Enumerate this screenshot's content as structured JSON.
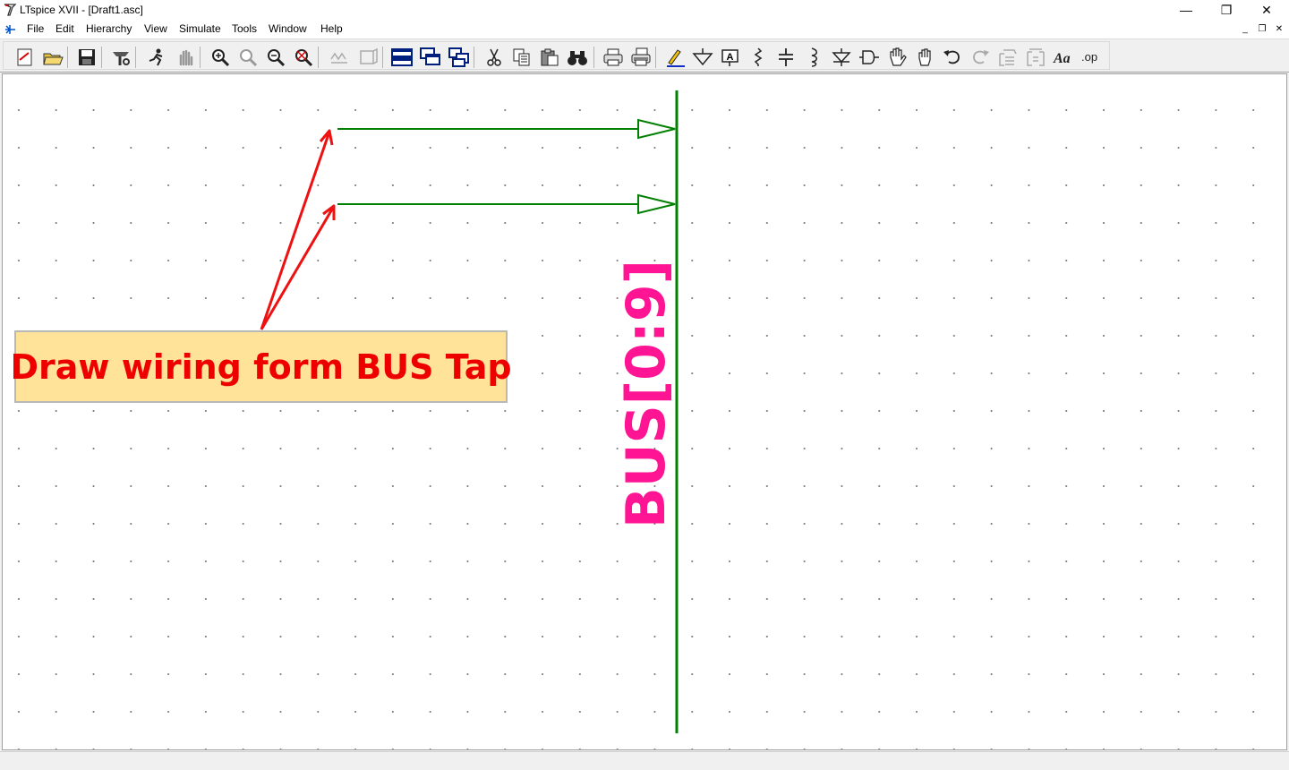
{
  "window": {
    "title": "LTspice XVII - [Draft1.asc]",
    "controls": {
      "minimize": "—",
      "restore": "❐",
      "close": "✕"
    },
    "mdi_controls": {
      "minimize": "_",
      "restore": "❐",
      "close": "✕"
    }
  },
  "menubar": {
    "items": [
      {
        "label": "File"
      },
      {
        "label": "Edit"
      },
      {
        "label": "Hierarchy"
      },
      {
        "label": "View"
      },
      {
        "label": "Simulate"
      },
      {
        "label": "Tools"
      },
      {
        "label": "Window"
      },
      {
        "label": "Help"
      }
    ]
  },
  "toolbar": {
    "buttons": [
      "new-schematic-icon",
      "open-icon",
      "save-icon",
      "control-panel-icon",
      "run-icon",
      "halt-icon",
      "zoom-in-icon",
      "pan-icon",
      "zoom-out-icon",
      "zoom-fit-icon",
      "autorange-icon",
      "vertical-autorange-icon",
      "tile-horizontal-icon",
      "cascade-icon",
      "tile-vertical-icon",
      "cut-icon",
      "copy-icon",
      "paste-icon",
      "find-icon",
      "print-icon",
      "print-setup-icon",
      "draw-wire-icon",
      "ground-icon",
      "label-net-icon",
      "resistor-icon",
      "capacitor-icon",
      "inductor-icon",
      "diode-icon",
      "component-icon",
      "move-icon",
      "drag-icon",
      "undo-icon",
      "redo-icon",
      "rotate-icon",
      "mirror-icon",
      "text-icon",
      "spice-directive-icon"
    ],
    "directive_label": ".op",
    "text_label": "Aa"
  },
  "schematic": {
    "wire_color": "#008000",
    "arrow_color": "#ee1111",
    "callout": {
      "text": "Draw wiring form BUS Tap",
      "bg": "#ffe399",
      "text_color": "#ee0000"
    },
    "bus_label": {
      "text": "BUS[0:9]",
      "color": "#ff1493"
    }
  }
}
